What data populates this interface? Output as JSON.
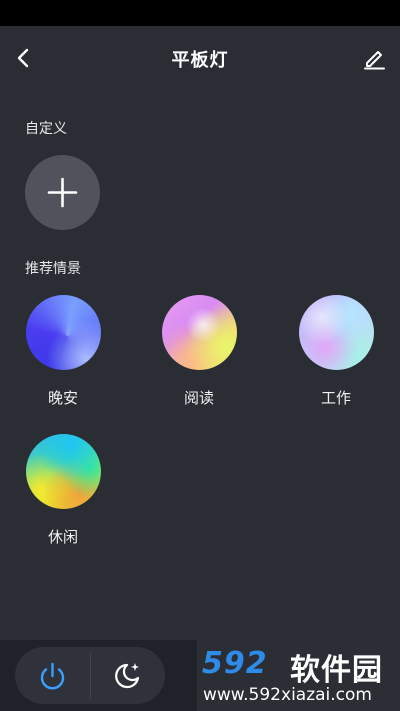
{
  "header": {
    "title": "平板灯",
    "back_icon": "chevron-left-icon",
    "edit_icon": "pencil-icon"
  },
  "custom": {
    "label": "自定义",
    "add_icon": "plus-icon"
  },
  "recommended": {
    "label": "推荐情景",
    "scenes": [
      {
        "label": "晚安"
      },
      {
        "label": "阅读"
      },
      {
        "label": "工作"
      },
      {
        "label": "休闲"
      }
    ]
  },
  "bottom": {
    "power_icon": "power-icon",
    "sleep_icon": "moon-star-icon",
    "accent": "#3aa0ff"
  },
  "watermark": {
    "logo": "592",
    "text": "软件园",
    "url": "www.592xiazai.com"
  }
}
